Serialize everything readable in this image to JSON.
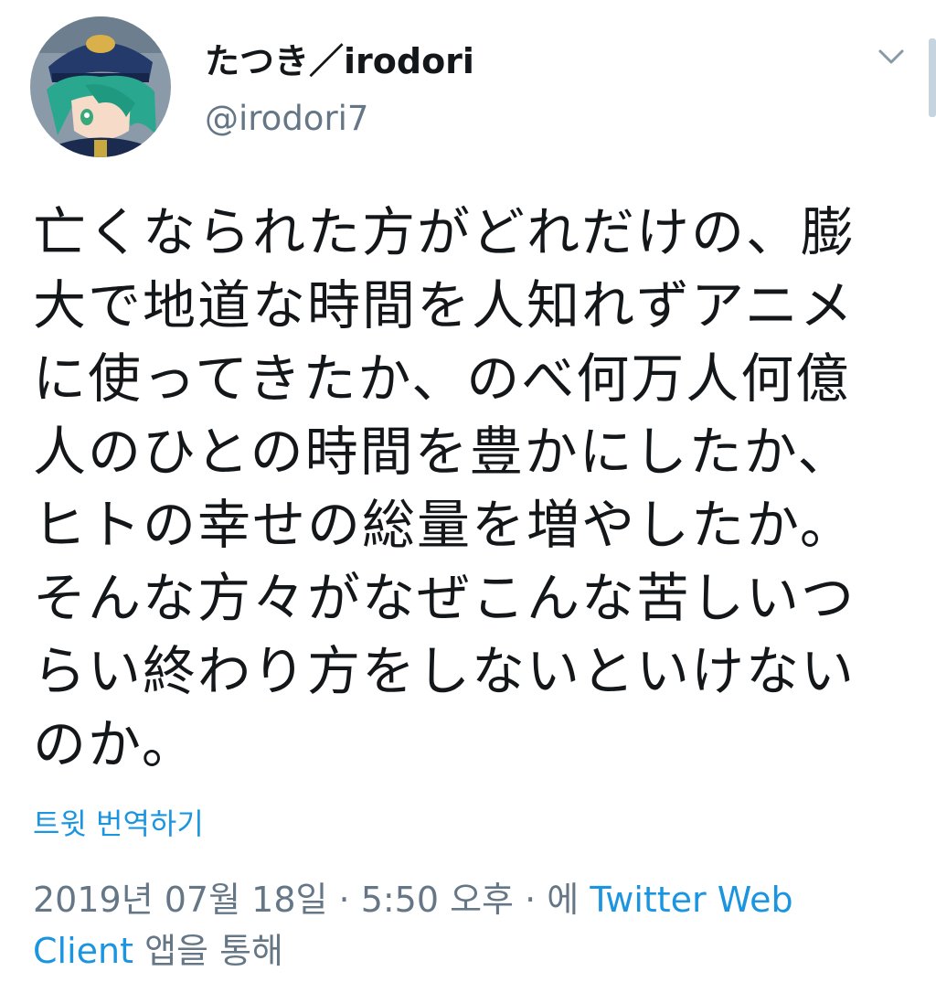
{
  "user": {
    "display_name": "たつき／irodori",
    "handle": "@irodori7"
  },
  "tweet": {
    "lines": [
      "亡くなられた方がどれだけの、膨",
      "大で地道な時間を人知れずアニメ",
      "に使ってきたか、のべ何万人何億",
      "人のひとの時間を豊かにしたか、",
      "ヒトの幸せの総量を増やしたか。",
      "そんな方々がなぜこんな苦しいつ",
      "らい終わり方をしないといけない",
      "のか。"
    ]
  },
  "translate_label": "트윗 번역하기",
  "meta": {
    "datetime": "2019년 07월 18일 · 5:50 오후 · 에 ",
    "client_part1": "Twitter Web",
    "client_part2": "Client",
    "suffix": " 앱을 통해"
  },
  "colors": {
    "link": "#1b95e0",
    "secondary": "#657786",
    "text": "#14171a"
  },
  "icons": {
    "menu": "chevron-down-icon",
    "avatar": "anime-character-avatar"
  }
}
